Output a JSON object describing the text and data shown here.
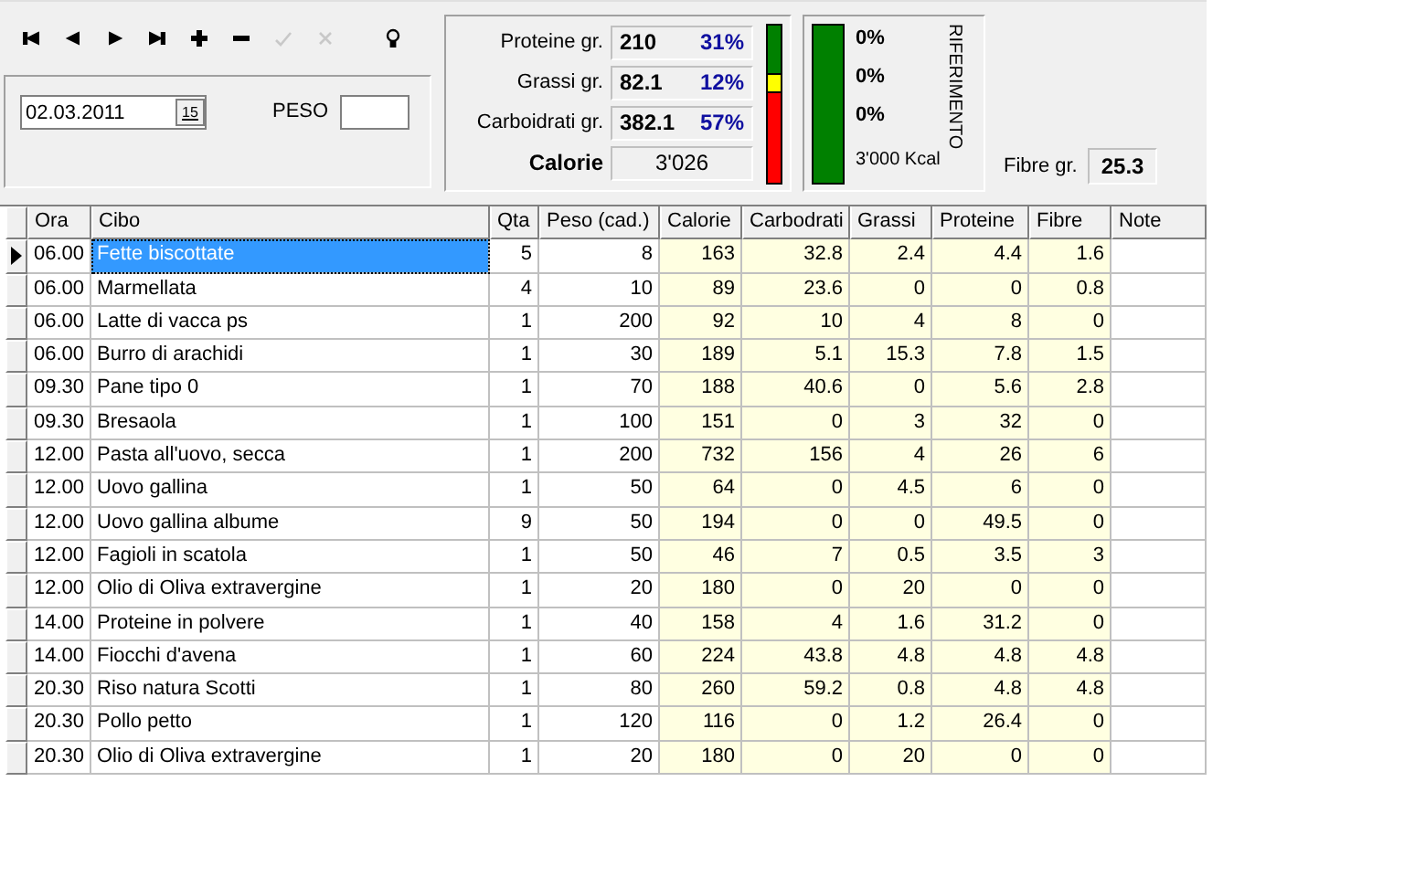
{
  "toolbar": [
    {
      "kind": "first",
      "disabled": false
    },
    {
      "kind": "prior",
      "disabled": false
    },
    {
      "kind": "next",
      "disabled": false
    },
    {
      "kind": "last",
      "disabled": false
    },
    {
      "kind": "insert",
      "disabled": false
    },
    {
      "kind": "delete",
      "disabled": false
    },
    {
      "kind": "post",
      "disabled": true
    },
    {
      "kind": "cancel",
      "disabled": true
    },
    {
      "kind": "hint",
      "disabled": false
    }
  ],
  "date": {
    "value": "02.03.2011",
    "calendar_button": "15"
  },
  "peso": {
    "label": "PESO"
  },
  "macros": [
    {
      "label": "Proteine gr.",
      "grams": "210",
      "percent": "31%",
      "color": "#008000"
    },
    {
      "label": "Grassi gr.",
      "grams": "82.1",
      "percent": "12%",
      "color": "#ffff00"
    },
    {
      "label": "Carboidrati gr.",
      "grams": "382.1",
      "percent": "57%",
      "color": "#ff0000"
    }
  ],
  "calorie": {
    "label": "Calorie",
    "value": "3'026"
  },
  "riferimento": {
    "title": "RIFERIMENTO",
    "percents": [
      "0%",
      "0%",
      "0%"
    ],
    "kcal": "3'000 Kcal"
  },
  "fibre": {
    "label": "Fibre gr.",
    "value": "25.3"
  },
  "table": {
    "columns": [
      {
        "label": "Ora",
        "kind": "time",
        "shaded": false
      },
      {
        "label": "Cibo",
        "kind": "text",
        "shaded": false
      },
      {
        "label": "Qta",
        "kind": "number",
        "shaded": false
      },
      {
        "label": "Peso (cad.)",
        "kind": "number",
        "shaded": false
      },
      {
        "label": "Calorie",
        "kind": "number",
        "shaded": true
      },
      {
        "label": "Carbodrati",
        "kind": "number",
        "shaded": true
      },
      {
        "label": "Grassi",
        "kind": "number",
        "shaded": true
      },
      {
        "label": "Proteine",
        "kind": "number",
        "shaded": true
      },
      {
        "label": "Fibre",
        "kind": "number",
        "shaded": true
      },
      {
        "label": "Note",
        "kind": "text",
        "shaded": false
      }
    ],
    "rows": [
      {
        "selected": true,
        "cells": [
          "06.00",
          "Fette biscottate",
          "5",
          "8",
          "163",
          "32.8",
          "2.4",
          "4.4",
          "1.6"
        ]
      },
      {
        "selected": false,
        "cells": [
          "06.00",
          "Marmellata",
          "4",
          "10",
          "89",
          "23.6",
          "0",
          "0",
          "0.8"
        ]
      },
      {
        "selected": false,
        "cells": [
          "06.00",
          "Latte di vacca ps",
          "1",
          "200",
          "92",
          "10",
          "4",
          "8",
          "0"
        ]
      },
      {
        "selected": false,
        "cells": [
          "06.00",
          "Burro di arachidi",
          "1",
          "30",
          "189",
          "5.1",
          "15.3",
          "7.8",
          "1.5"
        ]
      },
      {
        "selected": false,
        "cells": [
          "09.30",
          "Pane tipo 0",
          "1",
          "70",
          "188",
          "40.6",
          "0",
          "5.6",
          "2.8"
        ]
      },
      {
        "selected": false,
        "cells": [
          "09.30",
          "Bresaola",
          "1",
          "100",
          "151",
          "0",
          "3",
          "32",
          "0"
        ]
      },
      {
        "selected": false,
        "cells": [
          "12.00",
          "Pasta all'uovo, secca",
          "1",
          "200",
          "732",
          "156",
          "4",
          "26",
          "6"
        ]
      },
      {
        "selected": false,
        "cells": [
          "12.00",
          "Uovo gallina",
          "1",
          "50",
          "64",
          "0",
          "4.5",
          "6",
          "0"
        ]
      },
      {
        "selected": false,
        "cells": [
          "12.00",
          "Uovo gallina albume",
          "9",
          "50",
          "194",
          "0",
          "0",
          "49.5",
          "0"
        ]
      },
      {
        "selected": false,
        "cells": [
          "12.00",
          "Fagioli in scatola",
          "1",
          "50",
          "46",
          "7",
          "0.5",
          "3.5",
          "3"
        ]
      },
      {
        "selected": false,
        "cells": [
          "12.00",
          "Olio di Oliva extravergine",
          "1",
          "20",
          "180",
          "0",
          "20",
          "0",
          "0"
        ]
      },
      {
        "selected": false,
        "cells": [
          "14.00",
          "Proteine in polvere",
          "1",
          "40",
          "158",
          "4",
          "1.6",
          "31.2",
          "0"
        ]
      },
      {
        "selected": false,
        "cells": [
          "14.00",
          "Fiocchi d'avena",
          "1",
          "60",
          "224",
          "43.8",
          "4.8",
          "4.8",
          "4.8"
        ]
      },
      {
        "selected": false,
        "cells": [
          "20.30",
          "Riso natura Scotti",
          "1",
          "80",
          "260",
          "59.2",
          "0.8",
          "4.8",
          "4.8"
        ]
      },
      {
        "selected": false,
        "cells": [
          "20.30",
          "Pollo petto",
          "1",
          "120",
          "116",
          "0",
          "1.2",
          "26.4",
          "0"
        ]
      },
      {
        "selected": false,
        "cells": [
          "20.30",
          "Olio di Oliva extravergine",
          "1",
          "20",
          "180",
          "0",
          "20",
          "0",
          "0"
        ]
      }
    ]
  }
}
